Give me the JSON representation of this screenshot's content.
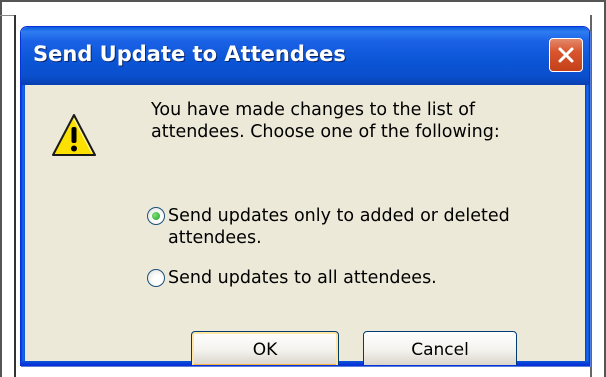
{
  "dialog": {
    "title": "Send Update to Attendees",
    "message": "You have made changes to the list of attendees. Choose one of the following:",
    "options": [
      {
        "label": "Send updates only to added or deleted attendees.",
        "selected": true
      },
      {
        "label": "Send updates to all attendees.",
        "selected": false
      }
    ],
    "ok_label": "OK",
    "cancel_label": "Cancel",
    "icon": "warning-icon",
    "close_icon": "close-icon"
  },
  "colors": {
    "titlebar": "#0a55d6",
    "body": "#ece9d8",
    "close": "#d9552d",
    "warning": "#fce100",
    "radio_selected": "#21a121"
  }
}
